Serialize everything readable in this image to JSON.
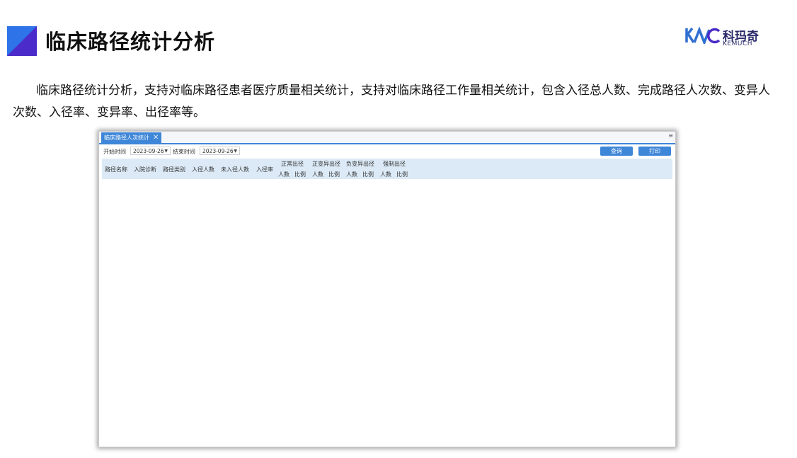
{
  "slide": {
    "title": "临床路径统计分析",
    "paragraph": "临床路径统计分析，支持对临床路径患者医疗质量相关统计，支持对临床路径工作量相关统计，包含入径总人数、完成路径人次数、变异人次数、入径率、变异率、出径率等。",
    "logo_cn": "科玛奇",
    "logo_en": "KEMUCH",
    "logo_mark": "kemuch-logo-mark"
  },
  "app": {
    "tab_label": "临床路径人次统计",
    "tab_close": "✕",
    "tab_menu": "≡",
    "start_label": "开始时间",
    "start_value": "2023-09-26",
    "end_label": "结束时间",
    "end_value": "2023-09-26",
    "query_button": "查询",
    "print_button": "打印",
    "columns": [
      "路径名称",
      "入院诊断",
      "路径类别",
      "入径人数",
      "未入径人数",
      "入径率"
    ],
    "groups": [
      {
        "label": "正常出径",
        "sub": [
          "人数",
          "比例"
        ]
      },
      {
        "label": "正变异出径",
        "sub": [
          "人数",
          "比例"
        ]
      },
      {
        "label": "负变异出径",
        "sub": [
          "人数",
          "比例"
        ]
      },
      {
        "label": "强制出径",
        "sub": [
          "人数",
          "比例"
        ]
      }
    ]
  },
  "colors": {
    "accent": "#3e86d8",
    "header_bg": "#dceaf7",
    "title_blue": "#2f73e8",
    "title_purple": "#4b2bc9"
  }
}
